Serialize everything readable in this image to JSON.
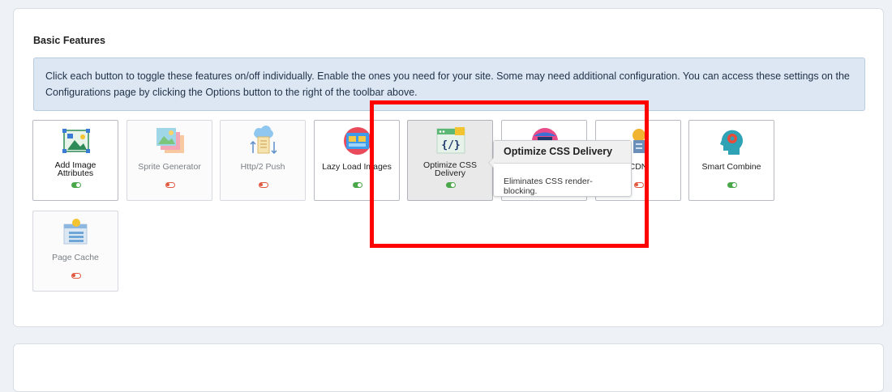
{
  "section": {
    "title": "Basic Features",
    "info": "Click each button to toggle these features on/off individually. Enable the ones you need for your site. Some may need additional configuration. You can access these settings on the Configurations page by clicking the Options button to the right of the toolbar above."
  },
  "features": [
    {
      "label": "Add Image Attributes",
      "enabled": true,
      "icon": "image-attributes-icon"
    },
    {
      "label": "Sprite Generator",
      "enabled": false,
      "icon": "sprite-generator-icon"
    },
    {
      "label": "Http/2 Push",
      "enabled": false,
      "icon": "cloud-push-icon"
    },
    {
      "label": "Lazy Load Images",
      "enabled": true,
      "icon": "lazy-load-icon"
    },
    {
      "label": "Optimize CSS Delivery",
      "enabled": true,
      "icon": "css-code-icon"
    },
    {
      "label": "",
      "enabled": false,
      "icon": "globe-icon"
    },
    {
      "label": "CDN",
      "enabled": false,
      "icon": "cdn-icon"
    },
    {
      "label": "Smart Combine",
      "enabled": true,
      "icon": "head-gear-icon"
    },
    {
      "label": "Page Cache",
      "enabled": false,
      "icon": "page-cache-icon"
    }
  ],
  "tooltip": {
    "title": "Optimize CSS Delivery",
    "body": "Eliminates CSS render-blocking."
  },
  "colors": {
    "toggle_on": "#4aa84a",
    "toggle_off": "#e0583f",
    "highlight": "#ff0000",
    "info_bg": "#dde7f3"
  }
}
